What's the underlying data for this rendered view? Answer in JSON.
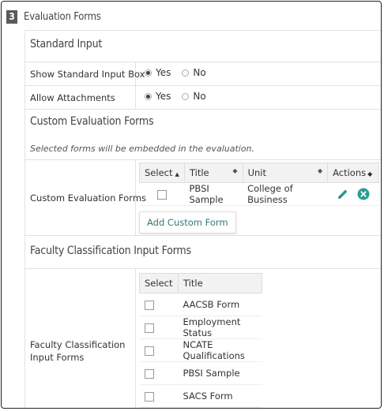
{
  "header": {
    "step_number": "3",
    "title": "Evaluation Forms"
  },
  "standard_input": {
    "title": "Standard Input",
    "rows": [
      {
        "label": "Show Standard Input Box",
        "yes": "Yes",
        "no": "No",
        "selected": "Yes"
      },
      {
        "label": "Allow Attachments",
        "yes": "Yes",
        "no": "No",
        "selected": "Yes"
      }
    ]
  },
  "custom_forms": {
    "title": "Custom Evaluation Forms",
    "note": "Selected forms will be embedded in the evaluation.",
    "row_label": "Custom Evaluation Forms",
    "columns": {
      "select": "Select",
      "title": "Title",
      "unit": "Unit",
      "actions": "Actions"
    },
    "rows": [
      {
        "title": "PBSI Sample",
        "unit": "College of Business"
      }
    ],
    "add_button": "Add Custom Form",
    "icons": {
      "edit": "pencil-icon",
      "delete": "x-circle-icon",
      "accent": "#2a9d8f"
    }
  },
  "faculty_forms": {
    "title": "Faculty Classification Input Forms",
    "row_label": "Faculty Classification Input Forms",
    "columns": {
      "select": "Select",
      "title": "Title"
    },
    "rows": [
      {
        "title": "AACSB Form"
      },
      {
        "title": "Employment Status"
      },
      {
        "title": "NCATE Qualifications"
      },
      {
        "title": "PBSI Sample"
      },
      {
        "title": "SACS Form"
      }
    ]
  }
}
